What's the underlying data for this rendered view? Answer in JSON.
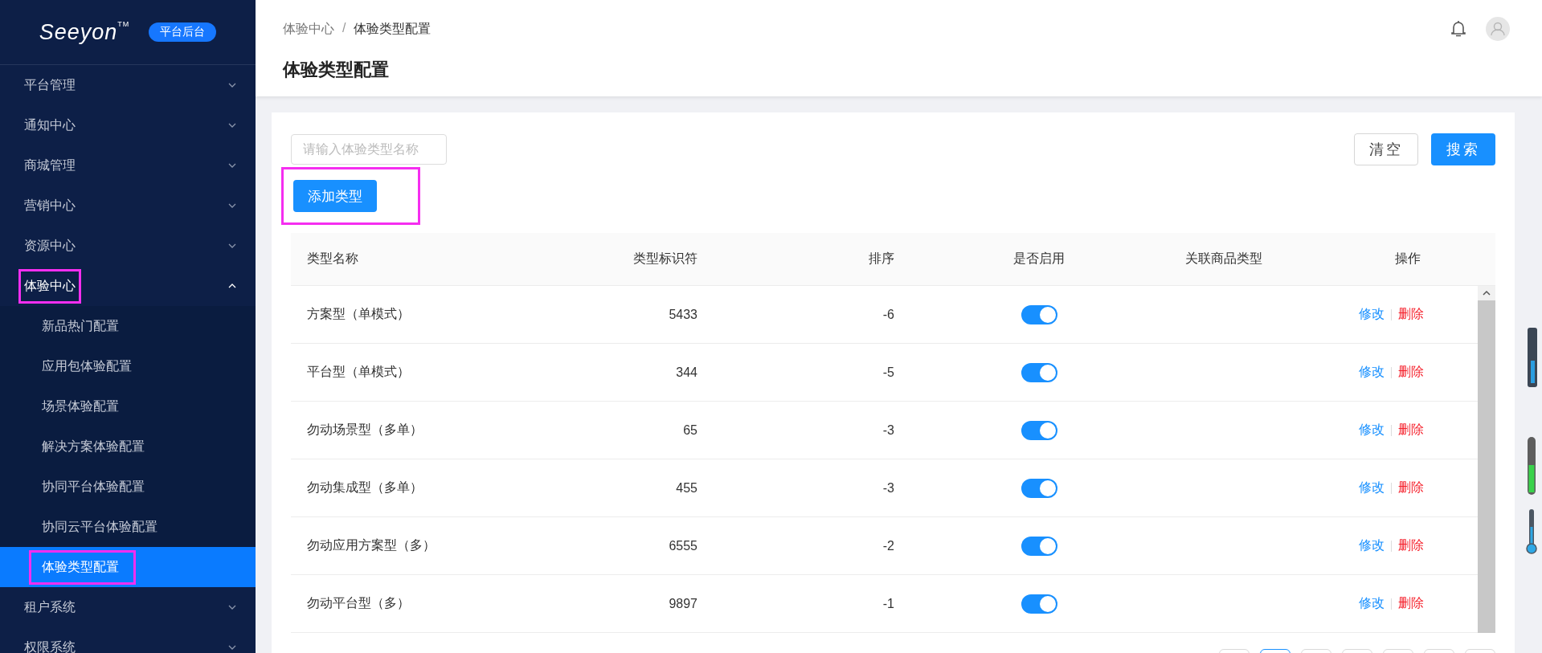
{
  "sidebar": {
    "logo": {
      "wordmark": "Seeyon",
      "trademark": "TM",
      "badge": "平台后台"
    },
    "items": [
      {
        "label": "平台管理",
        "expanded": false,
        "highlighted": false
      },
      {
        "label": "通知中心",
        "expanded": false,
        "highlighted": false
      },
      {
        "label": "商城管理",
        "expanded": false,
        "highlighted": false
      },
      {
        "label": "营销中心",
        "expanded": false,
        "highlighted": false
      },
      {
        "label": "资源中心",
        "expanded": false,
        "highlighted": false
      },
      {
        "label": "体验中心",
        "expanded": true,
        "highlighted": true,
        "children": [
          {
            "label": "新品热门配置",
            "selected": false,
            "highlighted": false
          },
          {
            "label": "应用包体验配置",
            "selected": false,
            "highlighted": false
          },
          {
            "label": "场景体验配置",
            "selected": false,
            "highlighted": false
          },
          {
            "label": "解决方案体验配置",
            "selected": false,
            "highlighted": false
          },
          {
            "label": "协同平台体验配置",
            "selected": false,
            "highlighted": false
          },
          {
            "label": "协同云平台体验配置",
            "selected": false,
            "highlighted": false
          },
          {
            "label": "体验类型配置",
            "selected": true,
            "highlighted": true
          }
        ]
      },
      {
        "label": "租户系统",
        "expanded": false,
        "highlighted": false
      },
      {
        "label": "权限系统",
        "expanded": false,
        "highlighted": false
      }
    ]
  },
  "breadcrumb": [
    "体验中心",
    "体验类型配置"
  ],
  "breadcrumb_separator": "/",
  "page_title": "体验类型配置",
  "search": {
    "placeholder": "请输入体验类型名称"
  },
  "buttons": {
    "clear": "清空",
    "search": "搜索",
    "add": "添加类型",
    "add_highlighted": true
  },
  "table": {
    "columns": [
      "类型名称",
      "类型标识符",
      "排序",
      "是否启用",
      "关联商品类型",
      "操作"
    ],
    "rows": [
      {
        "name": "方案型（单模式）",
        "identifier": "5433",
        "order": "-6",
        "enabled": true,
        "edit": "修改",
        "delete": "删除"
      },
      {
        "name": "平台型（单模式）",
        "identifier": "344",
        "order": "-5",
        "enabled": true,
        "edit": "修改",
        "delete": "删除"
      },
      {
        "name": "勿动场景型（多单）",
        "identifier": "65",
        "order": "-3",
        "enabled": true,
        "edit": "修改",
        "delete": "删除"
      },
      {
        "name": "勿动集成型（多单）",
        "identifier": "455",
        "order": "-3",
        "enabled": true,
        "edit": "修改",
        "delete": "删除"
      },
      {
        "name": "勿动应用方案型（多）",
        "identifier": "6555",
        "order": "-2",
        "enabled": true,
        "edit": "修改",
        "delete": "删除"
      },
      {
        "name": "勿动平台型（多）",
        "identifier": "9897",
        "order": "-1",
        "enabled": true,
        "edit": "修改",
        "delete": "删除"
      }
    ]
  },
  "pager": [
    {
      "selected": false
    },
    {
      "selected": true
    },
    {
      "selected": false
    },
    {
      "selected": false
    },
    {
      "selected": false
    },
    {
      "selected": false
    },
    {
      "selected": false
    }
  ]
}
